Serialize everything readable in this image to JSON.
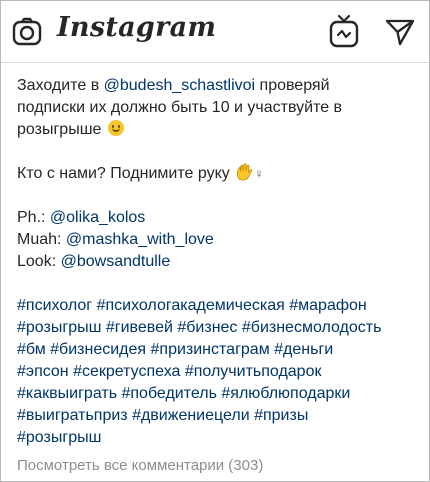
{
  "header": {
    "logo_text": "Instagram",
    "icons": [
      "camera-icon",
      "igtv-icon",
      "direct-message-icon"
    ]
  },
  "post": {
    "line1_prefix": "Заходите в ",
    "line1_mention": "@budesh_schastlivoi",
    "line1_suffix": " проверяй",
    "line2": "подписки их должно быть 10 и участвуйте в",
    "line3": "розыгрыше",
    "line4": "Кто с нами? Поднимите руку",
    "line4_glyph": "♀",
    "credits": [
      {
        "label": "Ph.: ",
        "handle": "@olika_kolos"
      },
      {
        "label": "Muah: ",
        "handle": "@mashka_with_love"
      },
      {
        "label": "Look: ",
        "handle": "@bowsandtulle"
      }
    ],
    "hashtag_lines": [
      "#психолог #психологакадемическая #марафон",
      "#розыгрыш #гивевей #бизнес #бизнесмолодость",
      "#бм #бизнесидея #призинстаграм #деньги",
      "#эпсон #секретуспеха #получитьподарок",
      "#каквыиграть #победитель #ялюблюподарки",
      "#выигратьприз #движениецели #призы",
      "#розыгрыш"
    ]
  },
  "comments_link": "Посмотреть все комментарии (303)",
  "colors": {
    "text": "#262626",
    "link": "#003569",
    "muted": "#8e8e8e",
    "divider": "#dbdbdb"
  }
}
